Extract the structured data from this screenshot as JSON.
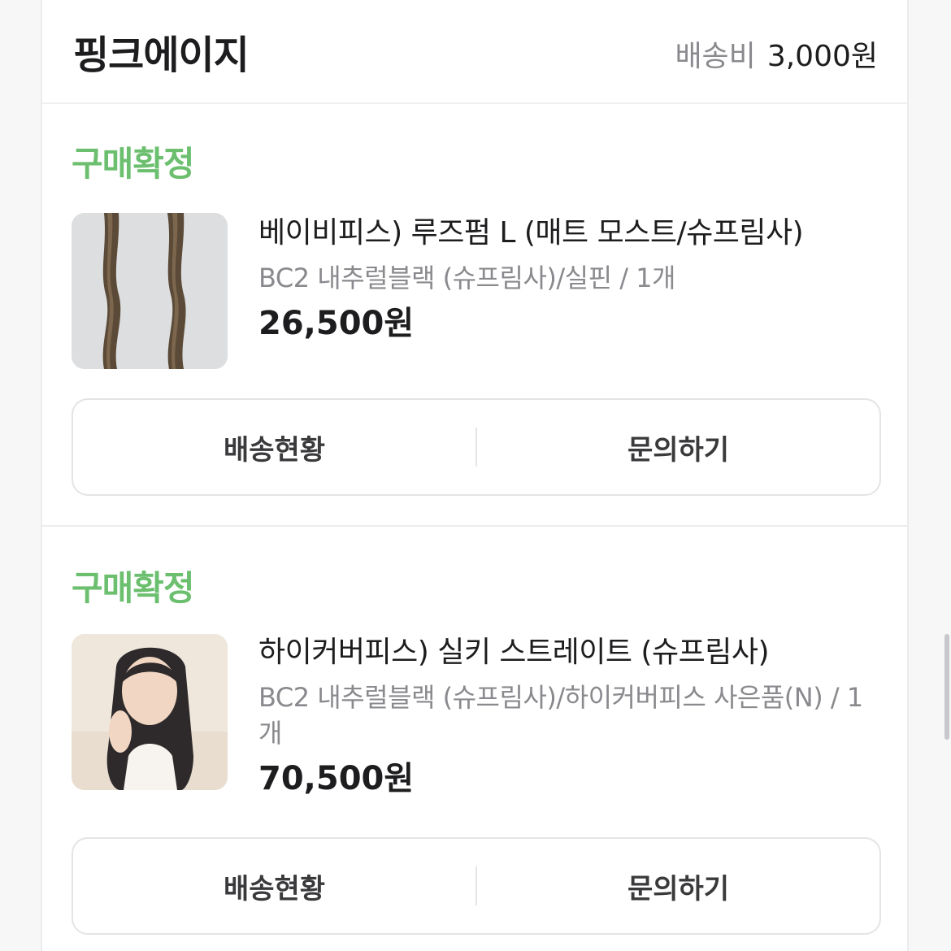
{
  "store": {
    "name": "핑크에이지"
  },
  "shipping": {
    "label": "배송비",
    "value": "3,000원"
  },
  "orders": [
    {
      "status": "구매확정",
      "image_icon": "hair-extension-product-image",
      "title": "베이비피스) 루즈펌 L (매트 모스트/슈프림사)",
      "option": "BC2 내추럴블랙 (슈프림사)/실핀 / 1개",
      "price": "26,500원",
      "actions": {
        "tracking": "배송현황",
        "inquiry": "문의하기"
      }
    },
    {
      "status": "구매확정",
      "image_icon": "model-wearing-hair-product-image",
      "title": "하이커버피스) 실키 스트레이트 (슈프림사)",
      "option": "BC2 내추럴블랙 (슈프림사)/하이커버피스 사은품(N) / 1개",
      "price": "70,500원",
      "actions": {
        "tracking": "배송현황",
        "inquiry": "문의하기"
      }
    }
  ],
  "colors": {
    "status_green": "#6cbf6e",
    "text_dark": "#1d1d1f",
    "text_gray": "#8a8a8e",
    "border": "#e4e4e7"
  }
}
